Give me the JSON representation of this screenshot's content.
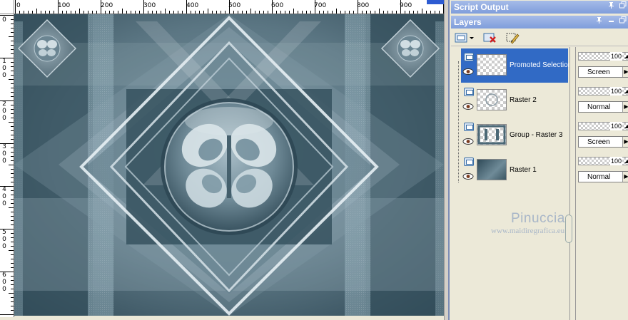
{
  "ruler": {
    "h_labels": [
      "0",
      "100",
      "200",
      "300",
      "400",
      "500",
      "600",
      "700",
      "800",
      "900"
    ],
    "v_labels": [
      [
        "0"
      ],
      [
        "1",
        "0",
        "0"
      ],
      [
        "2",
        "0",
        "0"
      ],
      [
        "3",
        "0",
        "0"
      ],
      [
        "4",
        "0",
        "0"
      ],
      [
        "5",
        "0",
        "0"
      ],
      [
        "6",
        "0",
        "0"
      ]
    ]
  },
  "script_output": {
    "title": "Script Output",
    "pin_icon": "pin-icon",
    "restore_icon": "restore-icon"
  },
  "layers_palette": {
    "title": "Layers",
    "pin_icon": "pin-icon",
    "minimize_icon": "minimize-icon",
    "restore_icon": "restore-icon",
    "toolbar": [
      "new-layer-icon",
      "delete-layer-icon",
      "edit-layer-icon"
    ],
    "layers": [
      {
        "name": "Promoted Selection",
        "opacity": "100",
        "blend": "Screen",
        "selected": true
      },
      {
        "name": "Raster 2",
        "opacity": "100",
        "blend": "Normal",
        "selected": false
      },
      {
        "name": "Group - Raster 3",
        "opacity": "100",
        "blend": "Screen",
        "selected": false
      },
      {
        "name": "Raster 1",
        "opacity": "100",
        "blend": "Normal",
        "selected": false
      }
    ]
  },
  "watermark": {
    "name": "Pinuccia",
    "url": "www.maidiregrafica.eu"
  },
  "colors": {
    "titlebar": "#7f9ddb",
    "selection": "#316ac5",
    "canvas_base": "#4c6774"
  }
}
